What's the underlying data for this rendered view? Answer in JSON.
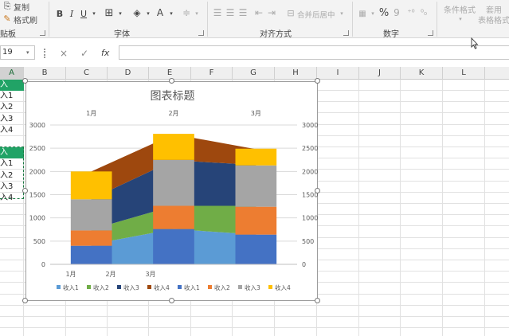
{
  "ribbon": {
    "clipboard": {
      "copy_label": "复制",
      "format_painter_label": "格式刷",
      "group_label": "贴板"
    },
    "font": {
      "group_label": "字体",
      "bold": "B",
      "italic": "I",
      "underline": "U",
      "font_color": "A"
    },
    "alignment": {
      "group_label": "对齐方式",
      "merge_label": "合并后居中"
    },
    "number": {
      "group_label": "数字",
      "percent": "%",
      "comma": "9"
    },
    "styles": {
      "conditional_label": "条件格式",
      "table_label_1": "套用",
      "table_label_2": "表格格式"
    }
  },
  "formula_bar": {
    "name_box": "19",
    "cancel": "×",
    "enter": "✓",
    "fx": "fx",
    "value": ""
  },
  "columns": [
    "A",
    "B",
    "C",
    "D",
    "E",
    "F",
    "G",
    "H",
    "I",
    "J",
    "K",
    "L"
  ],
  "column_a_cells": [
    {
      "text": "入",
      "header": true
    },
    {
      "text": "入1",
      "header": false
    },
    {
      "text": "入2",
      "header": false
    },
    {
      "text": "入3",
      "header": false
    },
    {
      "text": "入4",
      "header": false
    },
    {
      "text": "",
      "header": false
    },
    {
      "text": "入",
      "header": true
    },
    {
      "text": "入1",
      "header": false
    },
    {
      "text": "入2",
      "header": false
    },
    {
      "text": "入3",
      "header": false
    },
    {
      "text": "入4",
      "header": false
    }
  ],
  "chart_data": {
    "type": "stacked-column-with-area",
    "title": "图表标题",
    "secondary_categories": [
      "1月",
      "2月",
      "3月"
    ],
    "primary_categories": [
      "1月",
      "2月",
      "3月"
    ],
    "ylim": [
      0,
      3000
    ],
    "y_ticks": [
      0,
      500,
      1000,
      1500,
      2000,
      2500,
      3000
    ],
    "secondary_y_ticks": [
      0,
      500,
      1000,
      1500,
      2000,
      2500,
      3000
    ],
    "grid": true,
    "legend_position": "bottom",
    "column_series": [
      {
        "name": "收入1",
        "color": "#4472c4",
        "values": [
          400,
          760,
          640
        ]
      },
      {
        "name": "收入2",
        "color": "#ed7d31",
        "values": [
          330,
          500,
          600
        ]
      },
      {
        "name": "收入3",
        "color": "#a5a5a5",
        "values": [
          670,
          990,
          890
        ]
      },
      {
        "name": "收入4",
        "color": "#ffc000",
        "values": [
          600,
          560,
          360
        ]
      }
    ],
    "area_series": [
      {
        "name": "收入1",
        "color": "#5b9bd5",
        "values": [
          430,
          760,
          640
        ]
      },
      {
        "name": "收入2",
        "color": "#70ad47",
        "values": [
          320,
          500,
          620
        ]
      },
      {
        "name": "收入3",
        "color": "#264478",
        "values": [
          660,
          980,
          880
        ]
      },
      {
        "name": "收入4",
        "color": "#9e480e",
        "values": [
          590,
          560,
          340
        ]
      }
    ],
    "legend": [
      {
        "name": "收入1",
        "color": "#5b9bd5"
      },
      {
        "name": "收入2",
        "color": "#70ad47"
      },
      {
        "name": "收入3",
        "color": "#264478"
      },
      {
        "name": "收入4",
        "color": "#9e480e"
      },
      {
        "name": "收入1",
        "color": "#4472c4"
      },
      {
        "name": "收入2",
        "color": "#ed7d31"
      },
      {
        "name": "收入3",
        "color": "#a5a5a5"
      },
      {
        "name": "收入4",
        "color": "#ffc000"
      }
    ]
  }
}
